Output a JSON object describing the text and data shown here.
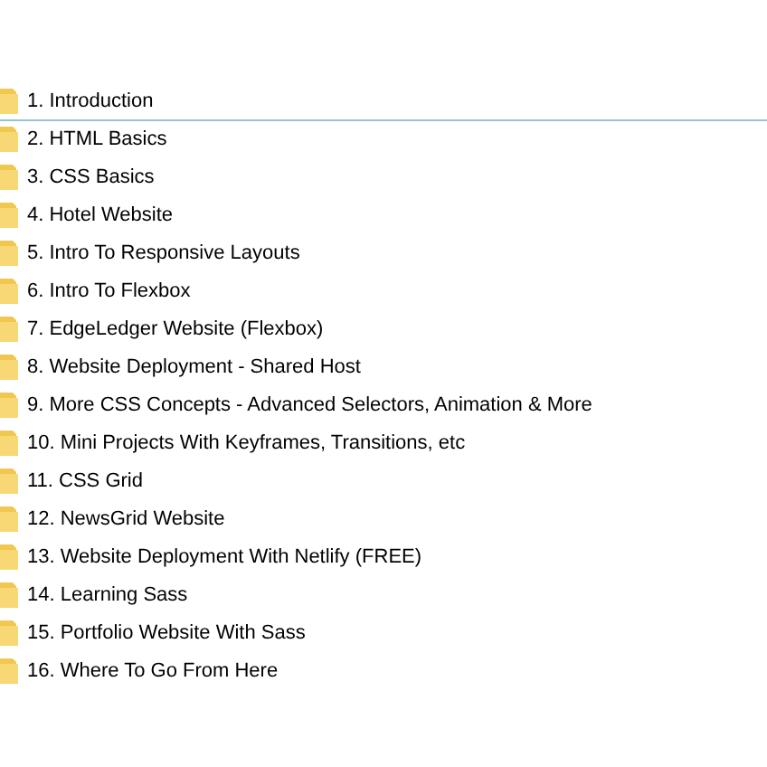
{
  "folders": [
    {
      "name": "1. Introduction",
      "focused": true
    },
    {
      "name": "2. HTML Basics",
      "focused": false
    },
    {
      "name": "3. CSS Basics",
      "focused": false
    },
    {
      "name": "4. Hotel Website",
      "focused": false
    },
    {
      "name": "5. Intro To Responsive Layouts",
      "focused": false
    },
    {
      "name": "6. Intro To Flexbox",
      "focused": false
    },
    {
      "name": "7. EdgeLedger Website (Flexbox)",
      "focused": false
    },
    {
      "name": "8. Website Deployment - Shared Host",
      "focused": false
    },
    {
      "name": "9. More CSS Concepts - Advanced Selectors, Animation & More",
      "focused": false
    },
    {
      "name": "10. Mini Projects With Keyframes, Transitions, etc",
      "focused": false
    },
    {
      "name": "11. CSS Grid",
      "focused": false
    },
    {
      "name": "12. NewsGrid Website",
      "focused": false
    },
    {
      "name": "13. Website Deployment With Netlify (FREE)",
      "focused": false
    },
    {
      "name": "14. Learning Sass",
      "focused": false
    },
    {
      "name": "15. Portfolio Website With Sass",
      "focused": false
    },
    {
      "name": "16. Where To Go From Here",
      "focused": false
    }
  ]
}
